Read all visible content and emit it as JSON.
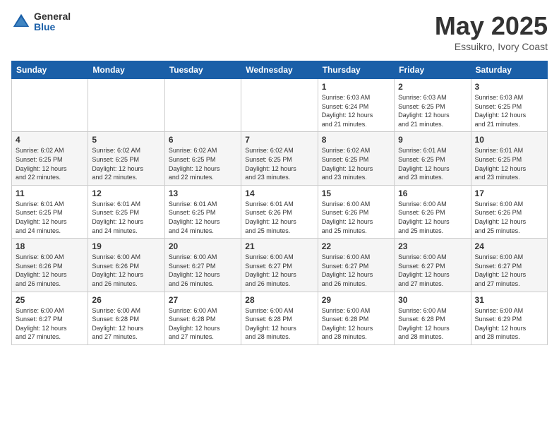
{
  "logo": {
    "general": "General",
    "blue": "Blue"
  },
  "title": "May 2025",
  "location": "Essuikro, Ivory Coast",
  "days_of_week": [
    "Sunday",
    "Monday",
    "Tuesday",
    "Wednesday",
    "Thursday",
    "Friday",
    "Saturday"
  ],
  "weeks": [
    [
      {
        "day": "",
        "info": ""
      },
      {
        "day": "",
        "info": ""
      },
      {
        "day": "",
        "info": ""
      },
      {
        "day": "",
        "info": ""
      },
      {
        "day": "1",
        "info": "Sunrise: 6:03 AM\nSunset: 6:24 PM\nDaylight: 12 hours\nand 21 minutes."
      },
      {
        "day": "2",
        "info": "Sunrise: 6:03 AM\nSunset: 6:25 PM\nDaylight: 12 hours\nand 21 minutes."
      },
      {
        "day": "3",
        "info": "Sunrise: 6:03 AM\nSunset: 6:25 PM\nDaylight: 12 hours\nand 21 minutes."
      }
    ],
    [
      {
        "day": "4",
        "info": "Sunrise: 6:02 AM\nSunset: 6:25 PM\nDaylight: 12 hours\nand 22 minutes."
      },
      {
        "day": "5",
        "info": "Sunrise: 6:02 AM\nSunset: 6:25 PM\nDaylight: 12 hours\nand 22 minutes."
      },
      {
        "day": "6",
        "info": "Sunrise: 6:02 AM\nSunset: 6:25 PM\nDaylight: 12 hours\nand 22 minutes."
      },
      {
        "day": "7",
        "info": "Sunrise: 6:02 AM\nSunset: 6:25 PM\nDaylight: 12 hours\nand 23 minutes."
      },
      {
        "day": "8",
        "info": "Sunrise: 6:02 AM\nSunset: 6:25 PM\nDaylight: 12 hours\nand 23 minutes."
      },
      {
        "day": "9",
        "info": "Sunrise: 6:01 AM\nSunset: 6:25 PM\nDaylight: 12 hours\nand 23 minutes."
      },
      {
        "day": "10",
        "info": "Sunrise: 6:01 AM\nSunset: 6:25 PM\nDaylight: 12 hours\nand 23 minutes."
      }
    ],
    [
      {
        "day": "11",
        "info": "Sunrise: 6:01 AM\nSunset: 6:25 PM\nDaylight: 12 hours\nand 24 minutes."
      },
      {
        "day": "12",
        "info": "Sunrise: 6:01 AM\nSunset: 6:25 PM\nDaylight: 12 hours\nand 24 minutes."
      },
      {
        "day": "13",
        "info": "Sunrise: 6:01 AM\nSunset: 6:25 PM\nDaylight: 12 hours\nand 24 minutes."
      },
      {
        "day": "14",
        "info": "Sunrise: 6:01 AM\nSunset: 6:26 PM\nDaylight: 12 hours\nand 25 minutes."
      },
      {
        "day": "15",
        "info": "Sunrise: 6:00 AM\nSunset: 6:26 PM\nDaylight: 12 hours\nand 25 minutes."
      },
      {
        "day": "16",
        "info": "Sunrise: 6:00 AM\nSunset: 6:26 PM\nDaylight: 12 hours\nand 25 minutes."
      },
      {
        "day": "17",
        "info": "Sunrise: 6:00 AM\nSunset: 6:26 PM\nDaylight: 12 hours\nand 25 minutes."
      }
    ],
    [
      {
        "day": "18",
        "info": "Sunrise: 6:00 AM\nSunset: 6:26 PM\nDaylight: 12 hours\nand 26 minutes."
      },
      {
        "day": "19",
        "info": "Sunrise: 6:00 AM\nSunset: 6:26 PM\nDaylight: 12 hours\nand 26 minutes."
      },
      {
        "day": "20",
        "info": "Sunrise: 6:00 AM\nSunset: 6:27 PM\nDaylight: 12 hours\nand 26 minutes."
      },
      {
        "day": "21",
        "info": "Sunrise: 6:00 AM\nSunset: 6:27 PM\nDaylight: 12 hours\nand 26 minutes."
      },
      {
        "day": "22",
        "info": "Sunrise: 6:00 AM\nSunset: 6:27 PM\nDaylight: 12 hours\nand 26 minutes."
      },
      {
        "day": "23",
        "info": "Sunrise: 6:00 AM\nSunset: 6:27 PM\nDaylight: 12 hours\nand 27 minutes."
      },
      {
        "day": "24",
        "info": "Sunrise: 6:00 AM\nSunset: 6:27 PM\nDaylight: 12 hours\nand 27 minutes."
      }
    ],
    [
      {
        "day": "25",
        "info": "Sunrise: 6:00 AM\nSunset: 6:27 PM\nDaylight: 12 hours\nand 27 minutes."
      },
      {
        "day": "26",
        "info": "Sunrise: 6:00 AM\nSunset: 6:28 PM\nDaylight: 12 hours\nand 27 minutes."
      },
      {
        "day": "27",
        "info": "Sunrise: 6:00 AM\nSunset: 6:28 PM\nDaylight: 12 hours\nand 27 minutes."
      },
      {
        "day": "28",
        "info": "Sunrise: 6:00 AM\nSunset: 6:28 PM\nDaylight: 12 hours\nand 28 minutes."
      },
      {
        "day": "29",
        "info": "Sunrise: 6:00 AM\nSunset: 6:28 PM\nDaylight: 12 hours\nand 28 minutes."
      },
      {
        "day": "30",
        "info": "Sunrise: 6:00 AM\nSunset: 6:28 PM\nDaylight: 12 hours\nand 28 minutes."
      },
      {
        "day": "31",
        "info": "Sunrise: 6:00 AM\nSunset: 6:29 PM\nDaylight: 12 hours\nand 28 minutes."
      }
    ]
  ]
}
